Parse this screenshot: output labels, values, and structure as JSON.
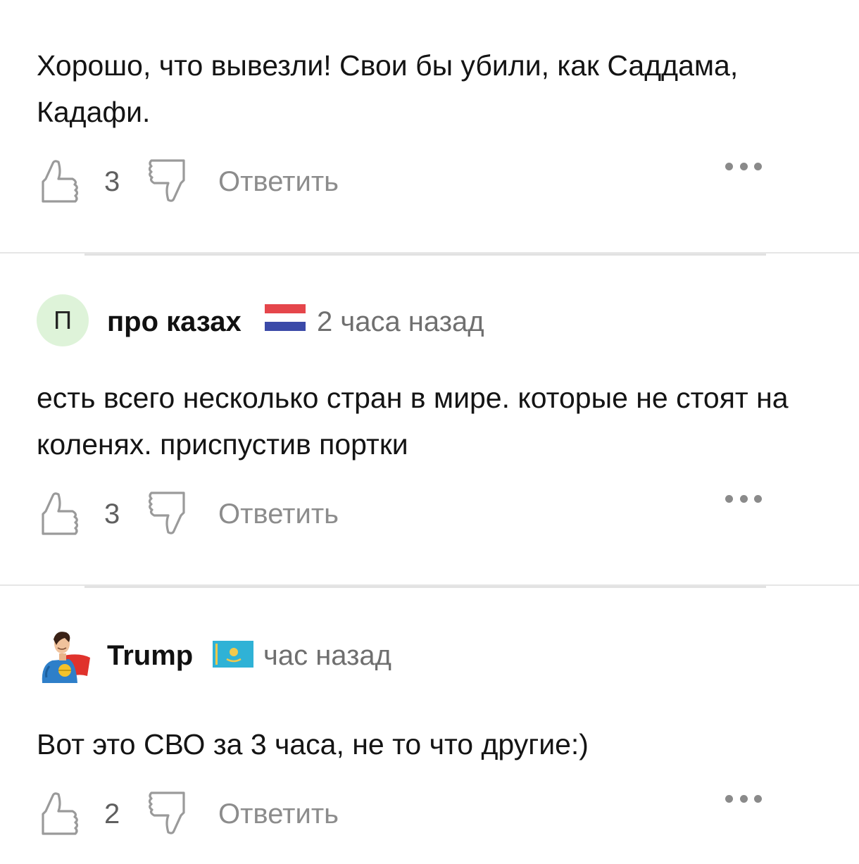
{
  "comments": [
    {
      "text": "Хорошо, что вывезли! Свои бы убили, как Саддама, Кадафи.",
      "likes": "3",
      "reply_label": "Ответить"
    },
    {
      "avatar_letter": "П",
      "author": "про казах",
      "flag": "netherlands-flag",
      "time": "2 часа назад",
      "text": "есть всего несколько стран в мире. которые не стоят на коленях. приспустив портки",
      "likes": "3",
      "reply_label": "Ответить"
    },
    {
      "avatar": "superhero-avatar",
      "author": "Trump",
      "flag": "kazakhstan-flag",
      "time": "час назад",
      "text": "Вот это СВО за 3 часа, не то что другие:)",
      "likes": "2",
      "reply_label": "Ответить"
    }
  ],
  "colors": {
    "avatar_bg": "#def3d9",
    "muted_text": "#8c8c8c",
    "divider": "#e6e6e6"
  }
}
